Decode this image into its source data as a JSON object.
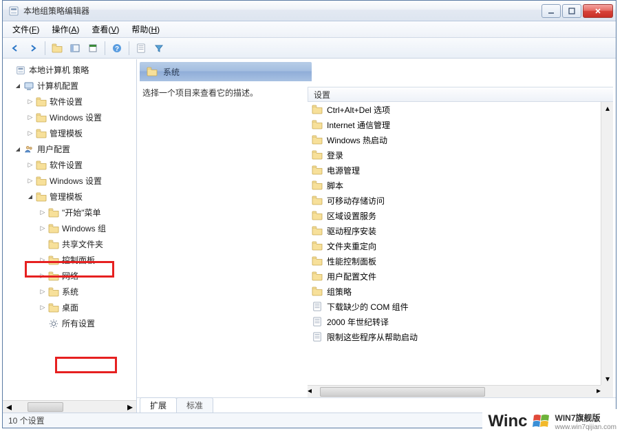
{
  "window": {
    "title": "本地组策略编辑器"
  },
  "menu": {
    "file": {
      "label": "文件",
      "accel": "F"
    },
    "action": {
      "label": "操作",
      "accel": "A"
    },
    "view": {
      "label": "查看",
      "accel": "V"
    },
    "help": {
      "label": "帮助",
      "accel": "H"
    }
  },
  "tree": {
    "root": "本地计算机 策略",
    "computer_config": "计算机配置",
    "cc_software": "软件设置",
    "cc_windows": "Windows 设置",
    "cc_admin": "管理模板",
    "user_config": "用户配置",
    "uc_software": "软件设置",
    "uc_windows": "Windows 设置",
    "uc_admin": "管理模板",
    "start_menu": "\"开始\"菜单",
    "windows_comp": "Windows 组",
    "shared": "共享文件夹",
    "control_panel": "控制面板",
    "network": "网络",
    "system": "系统",
    "desktop": "桌面",
    "all_settings": "所有设置"
  },
  "detail": {
    "header": "系统",
    "description": "选择一个项目来查看它的描述。",
    "column": "设置",
    "items": [
      "Ctrl+Alt+Del 选项",
      "Internet 通信管理",
      "Windows 热启动",
      "登录",
      "电源管理",
      "脚本",
      "可移动存储访问",
      "区域设置服务",
      "驱动程序安装",
      "文件夹重定向",
      "性能控制面板",
      "用户配置文件",
      "组策略",
      "下载缺少的 COM 组件",
      "2000 年世纪转译",
      "限制这些程序从帮助启动"
    ]
  },
  "tabs": {
    "extended": "扩展",
    "standard": "标准"
  },
  "status": "10 个设置",
  "watermark": {
    "big": "Winc",
    "brand": "WIN7旗舰版",
    "url": "www.win7qijian.com"
  }
}
